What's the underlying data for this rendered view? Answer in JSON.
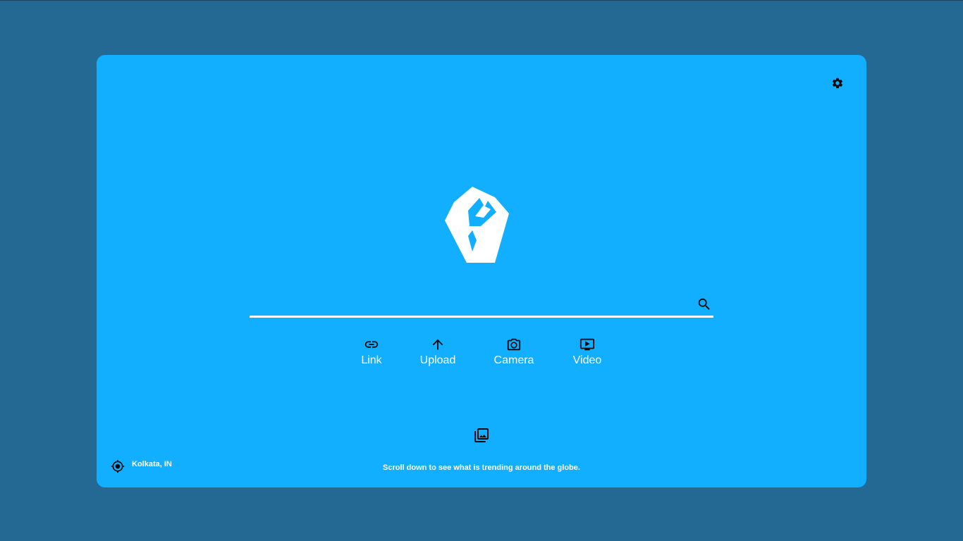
{
  "colors": {
    "page_background": "#246894",
    "card_background": "#12aeff",
    "foreground": "#ffffff",
    "icon": "#0a0a0a"
  },
  "header": {
    "settings_icon": "gear-icon"
  },
  "search": {
    "value": "",
    "placeholder": "",
    "button_icon": "search-icon"
  },
  "actions": [
    {
      "label": "Link",
      "icon": "link-icon"
    },
    {
      "label": "Upload",
      "icon": "arrow-up-icon"
    },
    {
      "label": "Camera",
      "icon": "camera-icon"
    },
    {
      "label": "Video",
      "icon": "video-icon"
    }
  ],
  "gallery": {
    "icon": "image-gallery-icon"
  },
  "footer": {
    "location_icon": "location-crosshair-icon",
    "location": "Kolkata, IN",
    "trending_hint": "Scroll down to see what is trending around the globe."
  }
}
